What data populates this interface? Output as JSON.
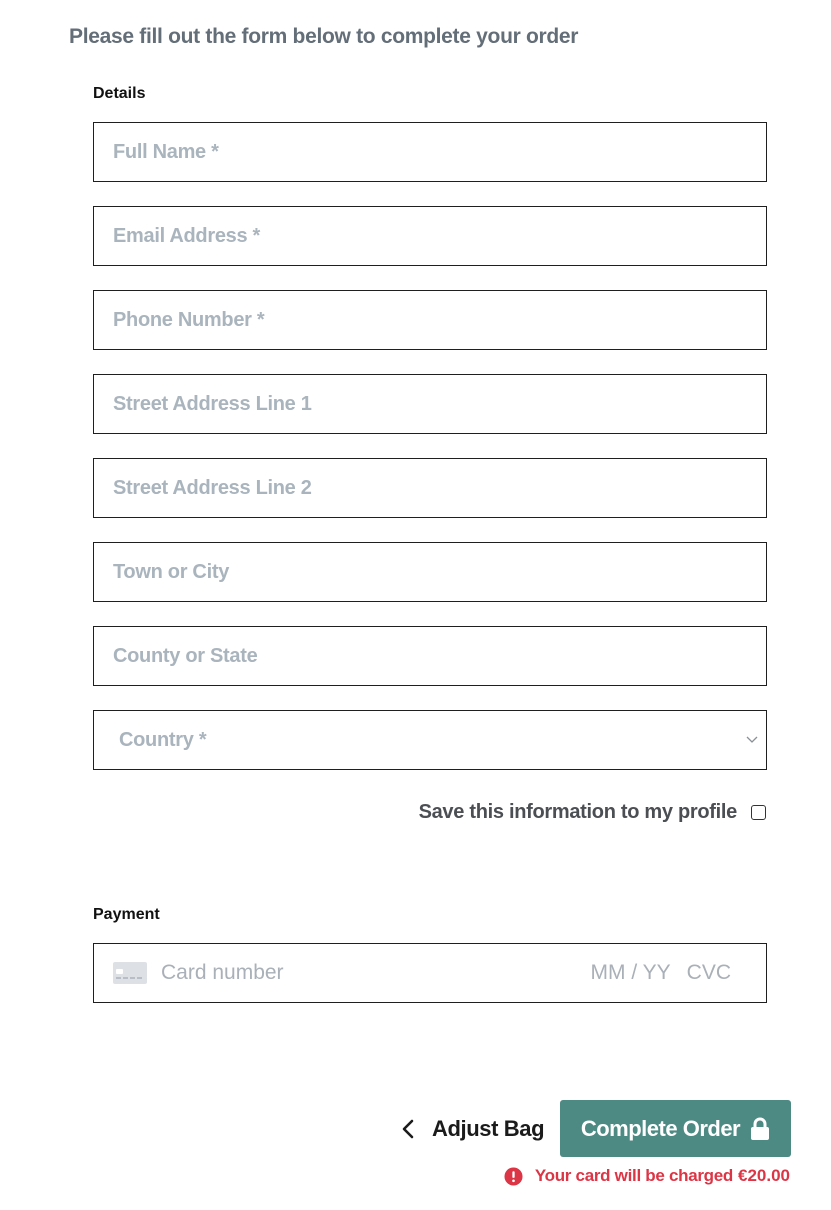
{
  "intro": "Please fill out the form below to complete your order",
  "details": {
    "label": "Details",
    "fields": [
      {
        "placeholder": "Full Name *"
      },
      {
        "placeholder": "Email Address *"
      },
      {
        "placeholder": "Phone Number *"
      },
      {
        "placeholder": "Street Address Line 1"
      },
      {
        "placeholder": "Street Address Line 2"
      },
      {
        "placeholder": "Town or City"
      },
      {
        "placeholder": "County or State"
      }
    ],
    "country": {
      "placeholder": "Country *",
      "icon": "chevron-down-icon"
    }
  },
  "save_profile": {
    "label": "Save this information to my profile",
    "checked": false
  },
  "payment": {
    "label": "Payment",
    "card_icon": "credit-card-icon",
    "card_placeholder": "Card number",
    "expiry_placeholder": "MM / YY",
    "cvc_placeholder": "CVC"
  },
  "actions": {
    "adjust_bag": "Adjust Bag",
    "complete_order": "Complete Order",
    "lock_icon": "lock-icon"
  },
  "charge_notice": {
    "text": "Your card will be charged",
    "amount": "€20.00",
    "icon": "alert-circle-icon",
    "color": "#dc3545"
  },
  "colors": {
    "button": "#4d8a84",
    "placeholder": "#a9b4bd"
  }
}
